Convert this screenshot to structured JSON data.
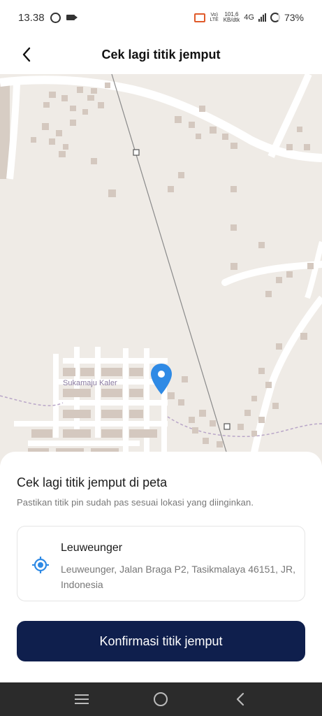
{
  "status_bar": {
    "time": "13.38",
    "volte_label": "Vo) LTE",
    "net_speed_value": "101,6",
    "net_speed_unit": "KB/dtk",
    "network_type": "4G",
    "battery": "73%"
  },
  "header": {
    "title": "Cek lagi titik jemput"
  },
  "map": {
    "place_label": "Sukamaju Kaler",
    "pin_color": "#2f8ae5"
  },
  "sheet": {
    "title": "Cek lagi titik jemput di peta",
    "subtitle": "Pastikan titik pin sudah pas sesuai lokasi yang diinginkan.",
    "location": {
      "name": "Leuweunger",
      "address": "Leuweunger, Jalan Braga P2, Tasikmalaya 46151, JR, Indonesia"
    },
    "confirm_label": "Konfirmasi titik jemput"
  },
  "colors": {
    "primary": "#0f1f4d",
    "accent": "#2f8ae5",
    "map_bg": "#efebe6",
    "nav_bg": "#2b2b2b"
  }
}
